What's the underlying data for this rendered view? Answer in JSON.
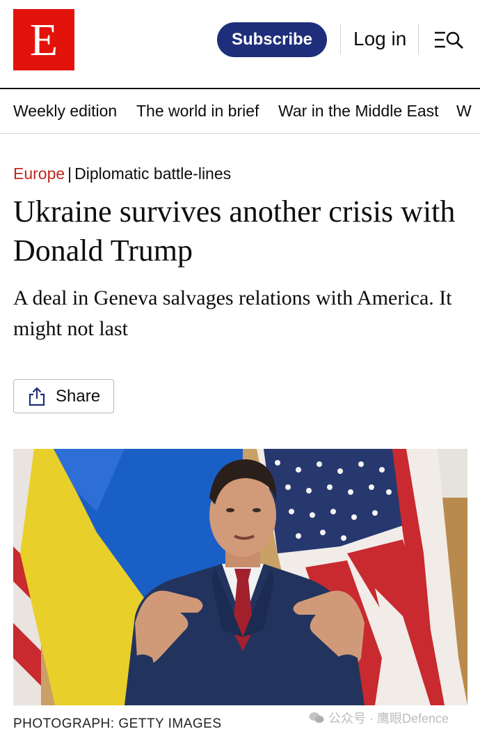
{
  "header": {
    "logo_letter": "E",
    "subscribe_label": "Subscribe",
    "login_label": "Log in",
    "menu_icon": "menu-search-icon"
  },
  "nav": {
    "items": [
      "Weekly edition",
      "The world in brief",
      "War in the Middle East",
      "W"
    ]
  },
  "article": {
    "section": "Europe",
    "separator": "|",
    "flytitle": "Diplomatic battle-lines",
    "headline": "Ukraine survives another crisis with Donald Trump",
    "standfirst": "A deal in Geneva salvages relations with America. It might not last",
    "share_label": "Share",
    "image_credit": "PHOTOGRAPH: GETTY IMAGES"
  },
  "watermark": {
    "text": "公众号 · 鹰眼Defence"
  },
  "colors": {
    "brand_red": "#e3120b",
    "subscribe_blue": "#1f2e7a",
    "section_red": "#c0281d"
  }
}
